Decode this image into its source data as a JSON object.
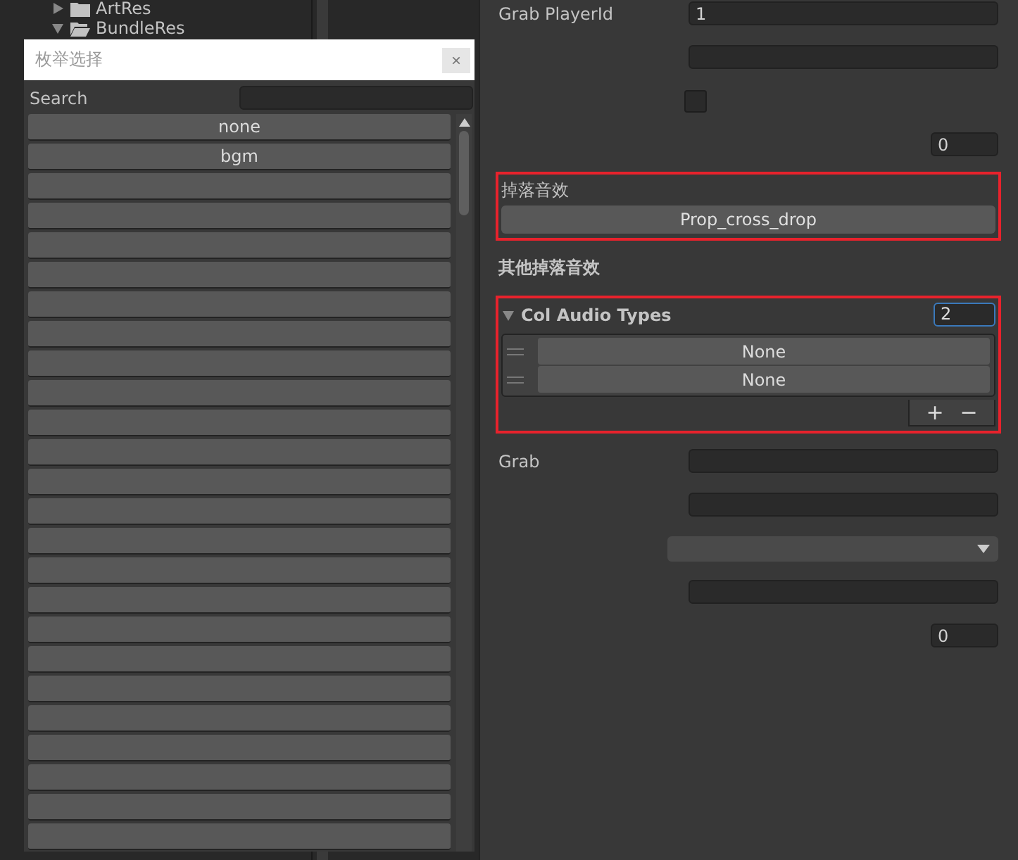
{
  "project_tree": {
    "items": [
      {
        "label": "ArtRes",
        "expanded": false
      },
      {
        "label": "BundleRes",
        "expanded": true
      }
    ]
  },
  "enum_popup": {
    "title": "枚举选择",
    "close": "×",
    "search_label": "Search",
    "options": [
      {
        "kind": "text",
        "label": "none"
      },
      {
        "kind": "text",
        "label": "bgm"
      },
      {
        "kind": "hidden"
      },
      {
        "kind": "hidden"
      },
      {
        "kind": "hidden"
      },
      {
        "kind": "hidden"
      },
      {
        "kind": "hidden"
      },
      {
        "kind": "hidden"
      },
      {
        "kind": "hidden"
      },
      {
        "kind": "hidden"
      },
      {
        "kind": "hidden"
      },
      {
        "kind": "hidden"
      },
      {
        "kind": "hidden"
      },
      {
        "kind": "hidden"
      },
      {
        "kind": "hidden"
      },
      {
        "kind": "hidden"
      },
      {
        "kind": "hidden"
      },
      {
        "kind": "hidden"
      },
      {
        "kind": "hidden"
      },
      {
        "kind": "hidden"
      },
      {
        "kind": "hidden"
      },
      {
        "kind": "hidden"
      },
      {
        "kind": "hidden"
      },
      {
        "kind": "hidden"
      },
      {
        "kind": "hidden"
      }
    ]
  },
  "inspector": {
    "rows": [
      {
        "kind": "field",
        "label": "Grab PlayerId",
        "value": "1"
      },
      {
        "kind": "field"
      },
      {
        "kind": "checkbox",
        "checked": false
      },
      {
        "kind": "number",
        "value": "0"
      },
      {
        "kind": "object",
        "label": "掉落音效",
        "value": "Prop_cross_drop",
        "highlighted": true
      },
      {
        "kind": "header",
        "label": "其他掉落音效"
      },
      {
        "kind": "list",
        "label": "Col Audio Types",
        "expanded": true,
        "size": "2",
        "items": [
          "None",
          "None"
        ],
        "add": "+",
        "remove": "−",
        "highlighted": true
      },
      {
        "kind": "field",
        "label": "Grab"
      },
      {
        "kind": "field"
      },
      {
        "kind": "dropdown"
      },
      {
        "kind": "field"
      },
      {
        "kind": "number",
        "value": "0"
      }
    ]
  }
}
